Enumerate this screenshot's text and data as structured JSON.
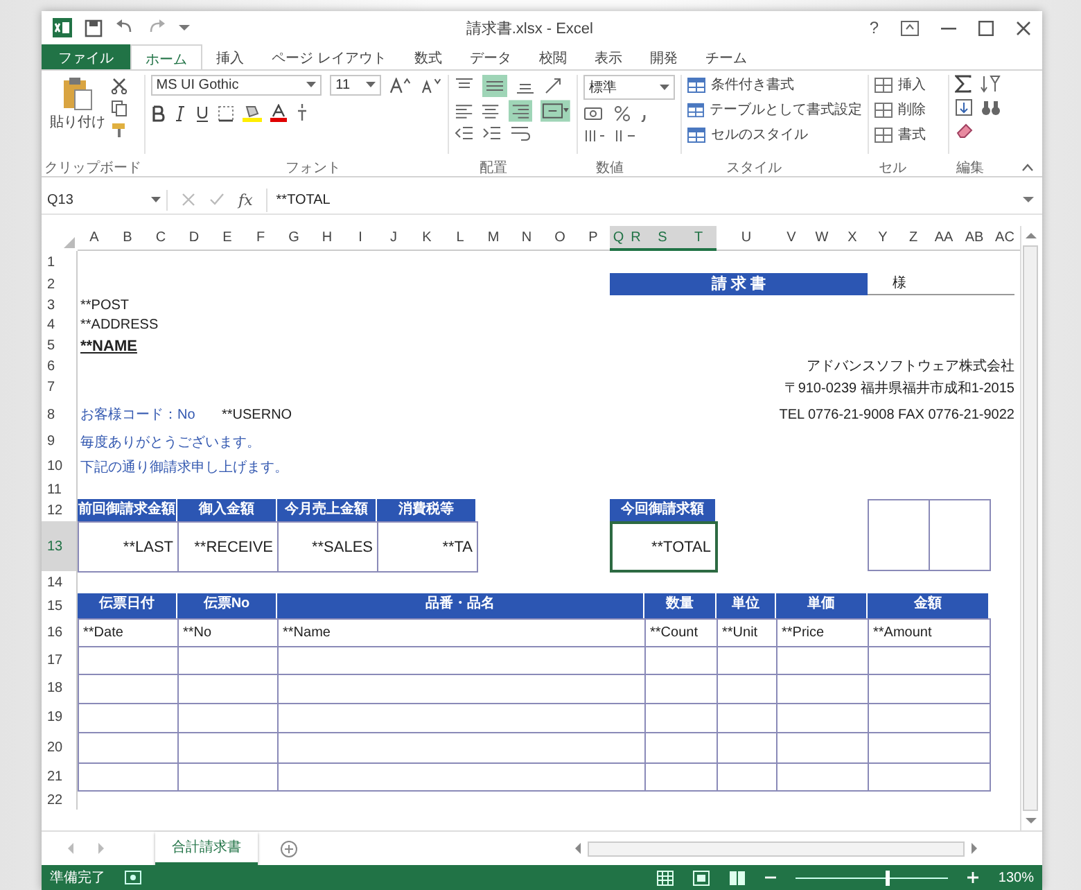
{
  "window": {
    "title": "請求書.xlsx - Excel",
    "help": "?"
  },
  "file_tab": "ファイル",
  "ribbon_tabs": [
    {
      "label": "ホーム",
      "selected": true
    },
    {
      "label": "挿入",
      "selected": false
    },
    {
      "label": "ページ レイアウト",
      "selected": false
    },
    {
      "label": "数式",
      "selected": false
    },
    {
      "label": "データ",
      "selected": false
    },
    {
      "label": "校閲",
      "selected": false
    },
    {
      "label": "表示",
      "selected": false
    },
    {
      "label": "開発",
      "selected": false
    },
    {
      "label": "チーム",
      "selected": false
    }
  ],
  "ribbon": {
    "paste": "貼り付け",
    "font_name": "MS UI Gothic",
    "font_size": "11",
    "number_format": "標準",
    "styles": [
      "条件付き書式",
      "テーブルとして書式設定",
      "セルのスタイル"
    ],
    "cells": [
      "挿入",
      "削除",
      "書式"
    ],
    "group_labels": [
      "クリップボード",
      "フォント",
      "配置",
      "数値",
      "スタイル",
      "セル",
      "編集"
    ]
  },
  "formula_bar": {
    "name_box": "Q13",
    "fx": "fx",
    "formula": "**TOTAL"
  },
  "columns": [
    {
      "label": "A",
      "selected": false
    },
    {
      "label": "B",
      "selected": false
    },
    {
      "label": "C",
      "selected": false
    },
    {
      "label": "D",
      "selected": false
    },
    {
      "label": "E",
      "selected": false
    },
    {
      "label": "F",
      "selected": false
    },
    {
      "label": "G",
      "selected": false
    },
    {
      "label": "H",
      "selected": false
    },
    {
      "label": "I",
      "selected": false
    },
    {
      "label": "J",
      "selected": false
    },
    {
      "label": "K",
      "selected": false
    },
    {
      "label": "L",
      "selected": false
    },
    {
      "label": "M",
      "selected": false
    },
    {
      "label": "N",
      "selected": false
    },
    {
      "label": "O",
      "selected": false
    },
    {
      "label": "P",
      "selected": false
    },
    {
      "label": "Q",
      "selected": true
    },
    {
      "label": "R",
      "selected": true
    },
    {
      "label": "S",
      "selected": true
    },
    {
      "label": "T",
      "selected": true
    },
    {
      "label": "U",
      "selected": false
    },
    {
      "label": "V",
      "selected": false
    },
    {
      "label": "W",
      "selected": false
    },
    {
      "label": "X",
      "selected": false
    },
    {
      "label": "Y",
      "selected": false
    },
    {
      "label": "Z",
      "selected": false
    },
    {
      "label": "AA",
      "selected": false
    },
    {
      "label": "AB",
      "selected": false
    },
    {
      "label": "AC",
      "selected": false
    }
  ],
  "rows": [
    {
      "label": "1",
      "selected": false
    },
    {
      "label": "2",
      "selected": false
    },
    {
      "label": "3",
      "selected": false
    },
    {
      "label": "4",
      "selected": false
    },
    {
      "label": "5",
      "selected": false
    },
    {
      "label": "6",
      "selected": false
    },
    {
      "label": "7",
      "selected": false
    },
    {
      "label": "8",
      "selected": false
    },
    {
      "label": "9",
      "selected": false
    },
    {
      "label": "10",
      "selected": false
    },
    {
      "label": "11",
      "selected": false
    },
    {
      "label": "12",
      "selected": false
    },
    {
      "label": "13",
      "selected": true
    },
    {
      "label": "14",
      "selected": false
    },
    {
      "label": "15",
      "selected": false
    },
    {
      "label": "16",
      "selected": false
    },
    {
      "label": "17",
      "selected": false
    },
    {
      "label": "18",
      "selected": false
    },
    {
      "label": "19",
      "selected": false
    },
    {
      "label": "20",
      "selected": false
    },
    {
      "label": "21",
      "selected": false
    },
    {
      "label": "22",
      "selected": false
    }
  ],
  "sheet": {
    "invoice_title": "請 求 書",
    "honorific": "様",
    "post": "**POST",
    "address": "**ADDRESS",
    "name": "**NAME",
    "company": [
      "アドバンスソフトウェア株式会社",
      "〒910-0239 福井県福井市成和1-2015",
      "TEL 0776-21-9008 FAX 0776-21-9022"
    ],
    "customer_code_label": "お客様コード：No",
    "customer_code": "**USERNO",
    "greeting": [
      "毎度ありがとうございます。",
      "下記の通り御請求申し上げます。"
    ],
    "summary": [
      {
        "header": "前回御請求金額",
        "value": "**LAST"
      },
      {
        "header": "御入金額",
        "value": "**RECEIVE"
      },
      {
        "header": "今月売上金額",
        "value": "**SALES"
      },
      {
        "header": "消費税等",
        "value": "**TA"
      }
    ],
    "total": {
      "header": "今回御請求額",
      "value": "**TOTAL",
      "selected": true
    },
    "detail_columns": [
      "伝票日付",
      "伝票No",
      "品番・品名",
      "数量",
      "単位",
      "単価",
      "金額"
    ],
    "detail_first_row": [
      "**Date",
      "**No",
      "**Name",
      "**Count",
      "**Unit",
      "**Price",
      "**Amount"
    ]
  },
  "sheet_tabs": [
    {
      "label": "合計請求書",
      "selected": true
    }
  ],
  "status_bar": {
    "status": "準備完了",
    "zoom": "130%",
    "level": 0.6
  }
}
